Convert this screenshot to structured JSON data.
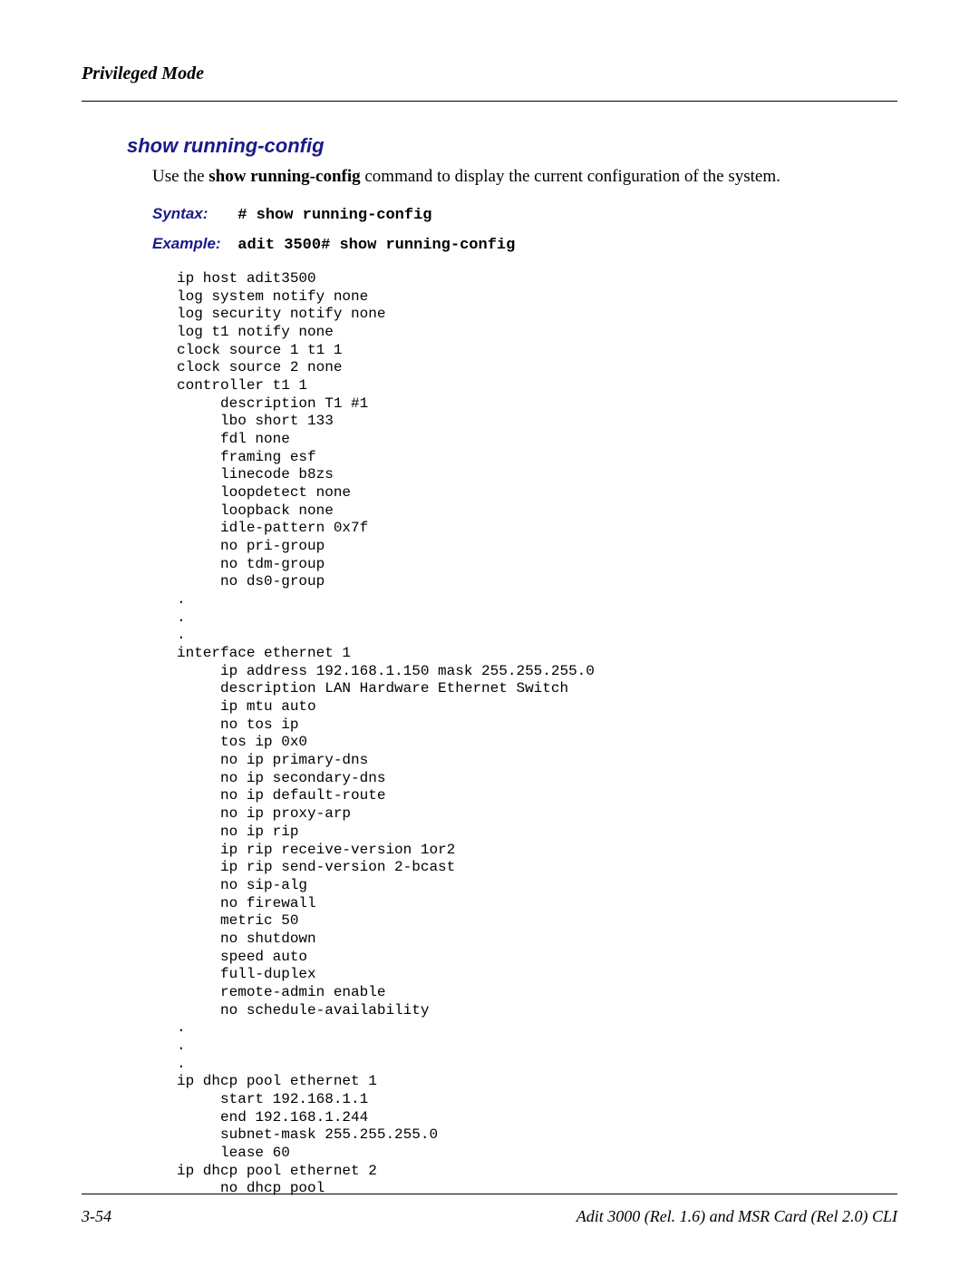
{
  "header": {
    "mode": "Privileged Mode"
  },
  "section": {
    "title": "show running-config",
    "intro_prefix": "Use the ",
    "intro_cmd": "show running-config",
    "intro_suffix": " command to display the current configuration of the system.",
    "syntax_label": "Syntax:",
    "syntax_value": "# show running-config",
    "example_label": "Example:",
    "example_value": "adit 3500# show running-config",
    "output": "ip host adit3500\nlog system notify none\nlog security notify none\nlog t1 notify none\nclock source 1 t1 1\nclock source 2 none\ncontroller t1 1\n     description T1 #1\n     lbo short 133\n     fdl none\n     framing esf\n     linecode b8zs\n     loopdetect none\n     loopback none\n     idle-pattern 0x7f\n     no pri-group\n     no tdm-group\n     no ds0-group\n.\n.\n.\ninterface ethernet 1\n     ip address 192.168.1.150 mask 255.255.255.0\n     description LAN Hardware Ethernet Switch\n     ip mtu auto\n     no tos ip\n     tos ip 0x0\n     no ip primary-dns\n     no ip secondary-dns\n     no ip default-route\n     no ip proxy-arp\n     no ip rip\n     ip rip receive-version 1or2\n     ip rip send-version 2-bcast\n     no sip-alg\n     no firewall\n     metric 50\n     no shutdown\n     speed auto\n     full-duplex\n     remote-admin enable\n     no schedule-availability\n.\n.\n.\nip dhcp pool ethernet 1\n     start 192.168.1.1\n     end 192.168.1.244\n     subnet-mask 255.255.255.0\n     lease 60\nip dhcp pool ethernet 2\n     no dhcp pool"
  },
  "footer": {
    "page_ref": "3-54",
    "doc_title": "Adit 3000 (Rel. 1.6) and MSR Card (Rel 2.0) CLI"
  }
}
